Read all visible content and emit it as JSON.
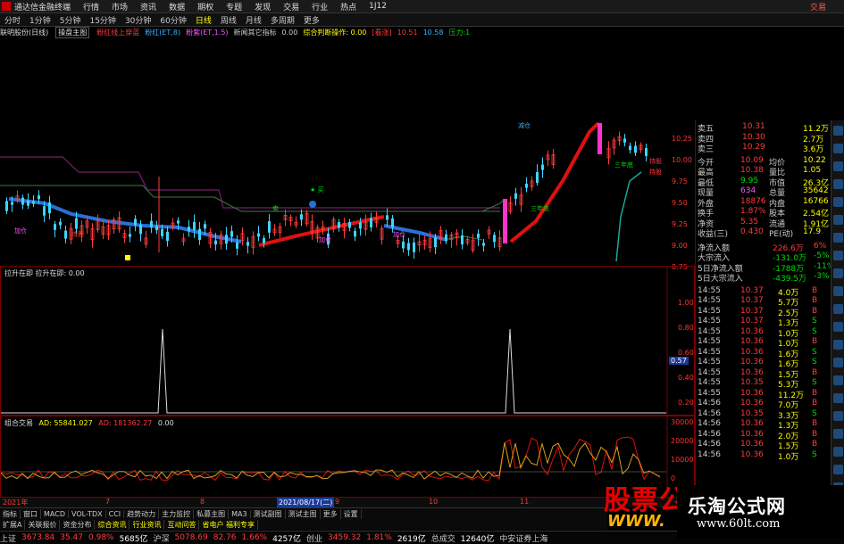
{
  "app": {
    "title": "通达信金融终端",
    "menu": [
      "行情",
      "市场",
      "资讯",
      "数据",
      "期权",
      "专题",
      "发现",
      "交易",
      "行业",
      "热点",
      "1J12"
    ],
    "trade_label": "交易"
  },
  "periods": {
    "items": [
      "分时",
      "1分钟",
      "5分钟",
      "15分钟",
      "30分钟",
      "60分钟",
      "日线",
      "周线",
      "月线",
      "多周期",
      "更多"
    ],
    "selected": "日线"
  },
  "indicator_line": {
    "stock": "联明股份(日线)",
    "indicator": "操盘主图",
    "tags": [
      {
        "text": "粉红线上穿蓝",
        "color": "#ff3b3b"
      },
      {
        "text": "粉红(ET,8)",
        "color": "#3bb0ff"
      },
      {
        "text": "粉紫(ET,1.5)",
        "color": "#ff55ff"
      },
      {
        "text": "新闻其它指标",
        "color": "#cccccc"
      },
      {
        "text": "0.00",
        "color": "#cccccc"
      },
      {
        "text": "综合判断操作: 0.00",
        "color": "#ffff00"
      },
      {
        "text": "[看涨]",
        "color": "#ff3b3b"
      },
      {
        "text": "10.51",
        "color": "#ff3b3b"
      },
      {
        "text": "10.58",
        "color": "#3bb0ff"
      },
      {
        "text": "压力:1",
        "color": "#00dd00"
      }
    ]
  },
  "main_chart": {
    "price_axis": [
      "10.25",
      "10.00",
      "9.75",
      "9.50",
      "9.25",
      "9.00",
      "8.75"
    ],
    "annotations": [
      {
        "text": "加仓",
        "color": "#ff55ff"
      },
      {
        "text": "持股",
        "color": "#ff3b3b"
      },
      {
        "text": "★ 买",
        "color": "#00dd00"
      },
      {
        "text": "卖",
        "color": "#00dd00"
      },
      {
        "text": "加仓",
        "color": "#ff55ff"
      },
      {
        "text": "加仓",
        "color": "#ff55ff"
      },
      {
        "text": "三年底",
        "color": "#00dd00"
      },
      {
        "text": "三年底",
        "color": "#00dd00"
      },
      {
        "text": "减仓",
        "color": "#3bb0ff"
      },
      {
        "text": "持股",
        "color": "#ff3b3b"
      },
      {
        "text": "持股",
        "color": "#ff3b3b"
      }
    ]
  },
  "panel2": {
    "label": "拉升在即  拉升在即: 0.00",
    "axis": [
      "1.00",
      "0.80",
      "0.60",
      "0.40",
      "0.20"
    ],
    "marker": "0.57"
  },
  "panel3": {
    "label_name": "组合交易",
    "label_ad": "AD: 55841.027",
    "label_ad2": "AD: 181362.27",
    "label_zero": "0.00",
    "axis": [
      "30000",
      "20000",
      "10000",
      "0"
    ]
  },
  "dateline": {
    "items": [
      "2021年",
      "7",
      "8",
      "9",
      "10",
      "11"
    ],
    "cursor_date": "2021/08/17(二)"
  },
  "tabs": [
    "指标",
    "窗口",
    "MACD",
    "VOL-TDX",
    "CCI",
    "趋势动力",
    "主力监控",
    "私募主图",
    "MA3",
    "测试副图",
    "测试主图",
    "更多",
    "设置"
  ],
  "tabs2": [
    {
      "text": "扩展A",
      "color": "#cccccc"
    },
    {
      "text": "关联报价",
      "color": "#cccccc"
    },
    {
      "text": "资金分布",
      "color": "#cccccc"
    },
    {
      "text": "综合资讯",
      "color": "#ffff00"
    },
    {
      "text": "行业资讯",
      "color": "#ffff00"
    },
    {
      "text": "互动问答",
      "color": "#ffff00"
    },
    {
      "text": "省电户 福利专享",
      "color": "#ffff00"
    }
  ],
  "status": [
    {
      "text": "上证",
      "color": "#cccccc"
    },
    {
      "text": "3673.84",
      "color": "#ff3b3b"
    },
    {
      "text": "35.47",
      "color": "#ff3b3b"
    },
    {
      "text": "0.98%",
      "color": "#ff3b3b"
    },
    {
      "text": "5685亿",
      "color": "#ffffff"
    },
    {
      "text": "沪深",
      "color": "#cccccc"
    },
    {
      "text": "5078.69",
      "color": "#ff3b3b"
    },
    {
      "text": "82.76",
      "color": "#ff3b3b"
    },
    {
      "text": "1.66%",
      "color": "#ff3b3b"
    },
    {
      "text": "4257亿",
      "color": "#ffffff"
    },
    {
      "text": "创业",
      "color": "#cccccc"
    },
    {
      "text": "3459.32",
      "color": "#ff3b3b"
    },
    {
      "text": "1.81%",
      "color": "#ff3b3b"
    },
    {
      "text": "2619亿",
      "color": "#ffffff"
    },
    {
      "text": "总成交",
      "color": "#cccccc"
    },
    {
      "text": "12640亿",
      "color": "#ffffff"
    },
    {
      "text": "中安证券上海",
      "color": "#cccccc"
    }
  ],
  "quote": {
    "sell_rows": [
      {
        "label": "卖五",
        "price": "10.31",
        "vol": "11.2万"
      },
      {
        "label": "卖四",
        "price": "10.30",
        "vol": "2.7万"
      },
      {
        "label": "卖三",
        "price": "10.29",
        "vol": "3.6万"
      }
    ],
    "stats": [
      {
        "l1": "今开",
        "v1": "10.09",
        "l2": "均价",
        "v2": "10.22"
      },
      {
        "l1": "最高",
        "v1": "10.38",
        "l2": "量比",
        "v2": "1.05"
      },
      {
        "l1": "最低",
        "v1": "9.95",
        "l2": "市值",
        "v2": "26.3亿"
      },
      {
        "l1": "现量",
        "v1": "634",
        "l2": "总量",
        "v2": "35642"
      },
      {
        "l1": "外盘",
        "v1": "18876",
        "l2": "内盘",
        "v2": "16766"
      },
      {
        "l1": "换手",
        "v1": "1.87%",
        "l2": "股本",
        "v2": "2.54亿"
      },
      {
        "l1": "净资",
        "v1": "5.35",
        "l2": "流通",
        "v2": "1.91亿"
      },
      {
        "l1": "收益(三)",
        "v1": "0.430",
        "l2": "PE(动)",
        "v2": "17.9"
      }
    ],
    "flows": [
      {
        "label": "净流入额",
        "value": "226.6万",
        "pct": "6%"
      },
      {
        "label": "大宗流入",
        "value": "-131.0万",
        "pct": "-5%"
      },
      {
        "label": "5日净流入额",
        "value": "-1788万",
        "pct": "-11%"
      },
      {
        "label": "5日大宗流入",
        "value": "-439.5万",
        "pct": "-3%"
      }
    ],
    "ticks": [
      {
        "t": "14:55",
        "p": "10.37",
        "v": "4.0万",
        "s": "B"
      },
      {
        "t": "14:55",
        "p": "10.37",
        "v": "5.7万",
        "s": "B"
      },
      {
        "t": "14:55",
        "p": "10.37",
        "v": "2.5万",
        "s": "B"
      },
      {
        "t": "14:55",
        "p": "10.37",
        "v": "1.3万",
        "s": "S"
      },
      {
        "t": "14:55",
        "p": "10.36",
        "v": "1.0万",
        "s": "S"
      },
      {
        "t": "14:55",
        "p": "10.36",
        "v": "1.0万",
        "s": "B"
      },
      {
        "t": "14:55",
        "p": "10.36",
        "v": "1.6万",
        "s": "S"
      },
      {
        "t": "14:55",
        "p": "10.36",
        "v": "1.6万",
        "s": "S"
      },
      {
        "t": "14:55",
        "p": "10.36",
        "v": "1.5万",
        "s": "B"
      },
      {
        "t": "14:55",
        "p": "10.35",
        "v": "5.3万",
        "s": "S"
      },
      {
        "t": "14:55",
        "p": "10.36",
        "v": "11.2万",
        "s": "B"
      },
      {
        "t": "14:56",
        "p": "10.36",
        "v": "7.0万",
        "s": "B"
      },
      {
        "t": "14:56",
        "p": "10.35",
        "v": "3.3万",
        "s": "S"
      },
      {
        "t": "14:56",
        "p": "10.36",
        "v": "1.3万",
        "s": "B"
      },
      {
        "t": "14:56",
        "p": "10.36",
        "v": "2.0万",
        "s": "B"
      },
      {
        "t": "14:56",
        "p": "10.36",
        "v": "1.5万",
        "s": "B"
      },
      {
        "t": "14:56",
        "p": "10.36",
        "v": "1.0万",
        "s": "S"
      }
    ]
  },
  "watermark": {
    "brand": "股票公式网",
    "url": "WWW.",
    "site": "乐淘公式网",
    "site_url": "www.60lt.com"
  },
  "colors": {
    "up": "#ff3b3b",
    "down": "#3bd6ff",
    "blue_line": "#2a6fd8",
    "red_line": "#e01010",
    "magenta": "#ff33cc",
    "frame": "#7a0000"
  }
}
